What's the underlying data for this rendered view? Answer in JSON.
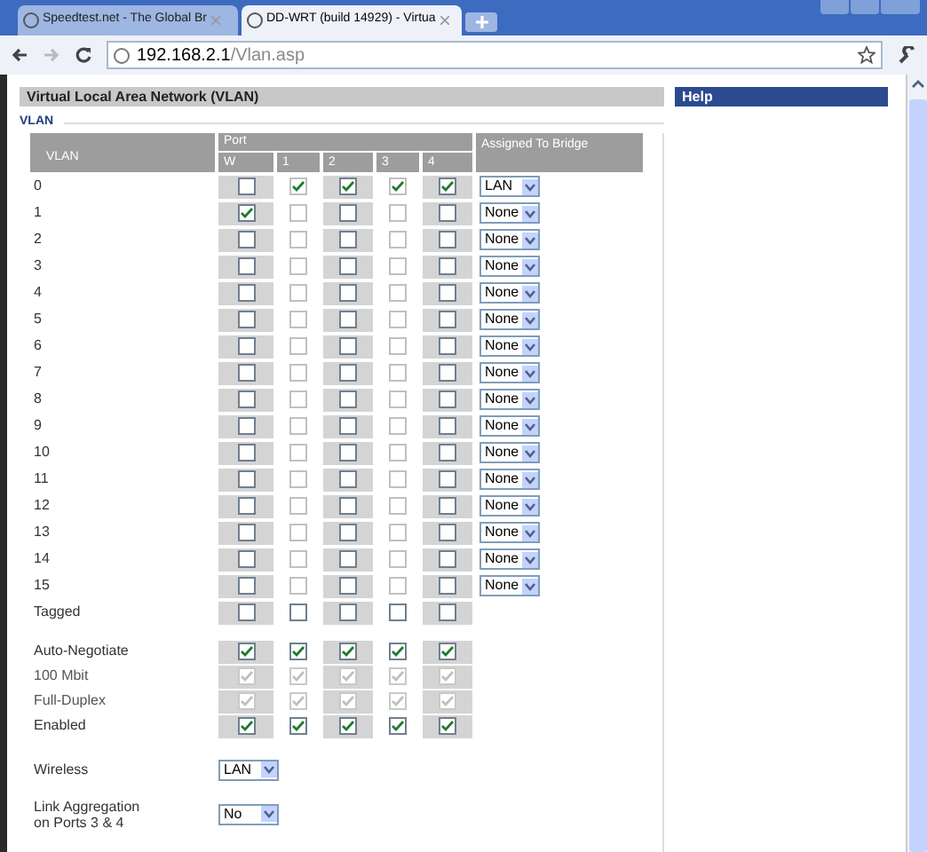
{
  "browser": {
    "tabs": [
      {
        "title": "Speedtest.net - The Global Br",
        "selected": false
      },
      {
        "title": "DD-WRT (build 14929) - Virtua",
        "selected": true
      }
    ],
    "address": {
      "host": "192.168.2.1",
      "path": "/Vlan.asp"
    }
  },
  "page_title": "Virtual Local Area Network (VLAN)",
  "help_title": "Help",
  "section": "VLAN",
  "table": {
    "columns": {
      "vlan": "VLAN",
      "port": "Port",
      "ports": [
        "W",
        "1",
        "2",
        "3",
        "4"
      ],
      "bridge": "Assigned To Bridge"
    },
    "rows": [
      {
        "label": "0",
        "ports": [
          false,
          true,
          true,
          true,
          true
        ],
        "bridge": "LAN"
      },
      {
        "label": "1",
        "ports": [
          true,
          false,
          false,
          false,
          false
        ],
        "bridge": "None"
      },
      {
        "label": "2",
        "ports": [
          false,
          false,
          false,
          false,
          false
        ],
        "bridge": "None"
      },
      {
        "label": "3",
        "ports": [
          false,
          false,
          false,
          false,
          false
        ],
        "bridge": "None"
      },
      {
        "label": "4",
        "ports": [
          false,
          false,
          false,
          false,
          false
        ],
        "bridge": "None"
      },
      {
        "label": "5",
        "ports": [
          false,
          false,
          false,
          false,
          false
        ],
        "bridge": "None"
      },
      {
        "label": "6",
        "ports": [
          false,
          false,
          false,
          false,
          false
        ],
        "bridge": "None"
      },
      {
        "label": "7",
        "ports": [
          false,
          false,
          false,
          false,
          false
        ],
        "bridge": "None"
      },
      {
        "label": "8",
        "ports": [
          false,
          false,
          false,
          false,
          false
        ],
        "bridge": "None"
      },
      {
        "label": "9",
        "ports": [
          false,
          false,
          false,
          false,
          false
        ],
        "bridge": "None"
      },
      {
        "label": "10",
        "ports": [
          false,
          false,
          false,
          false,
          false
        ],
        "bridge": "None"
      },
      {
        "label": "11",
        "ports": [
          false,
          false,
          false,
          false,
          false
        ],
        "bridge": "None"
      },
      {
        "label": "12",
        "ports": [
          false,
          false,
          false,
          false,
          false
        ],
        "bridge": "None"
      },
      {
        "label": "13",
        "ports": [
          false,
          false,
          false,
          false,
          false
        ],
        "bridge": "None"
      },
      {
        "label": "14",
        "ports": [
          false,
          false,
          false,
          false,
          false
        ],
        "bridge": "None"
      },
      {
        "label": "15",
        "ports": [
          false,
          false,
          false,
          false,
          false
        ],
        "bridge": "None"
      }
    ],
    "tagged": {
      "label": "Tagged",
      "ports": [
        false,
        false,
        false,
        false,
        false
      ]
    }
  },
  "port_settings": [
    {
      "label": "Auto-Negotiate",
      "disabled": false,
      "ports": [
        true,
        true,
        true,
        true,
        true
      ]
    },
    {
      "label": "100 Mbit",
      "disabled": true,
      "ports": [
        true,
        true,
        true,
        true,
        true
      ]
    },
    {
      "label": "Full-Duplex",
      "disabled": true,
      "ports": [
        true,
        true,
        true,
        true,
        true
      ]
    },
    {
      "label": "Enabled",
      "disabled": false,
      "ports": [
        true,
        true,
        true,
        true,
        true
      ]
    }
  ],
  "wireless": {
    "label": "Wireless",
    "value": "LAN"
  },
  "link_aggregation": {
    "label": "Link Aggregation on Ports 3 & 4",
    "value": "No"
  }
}
